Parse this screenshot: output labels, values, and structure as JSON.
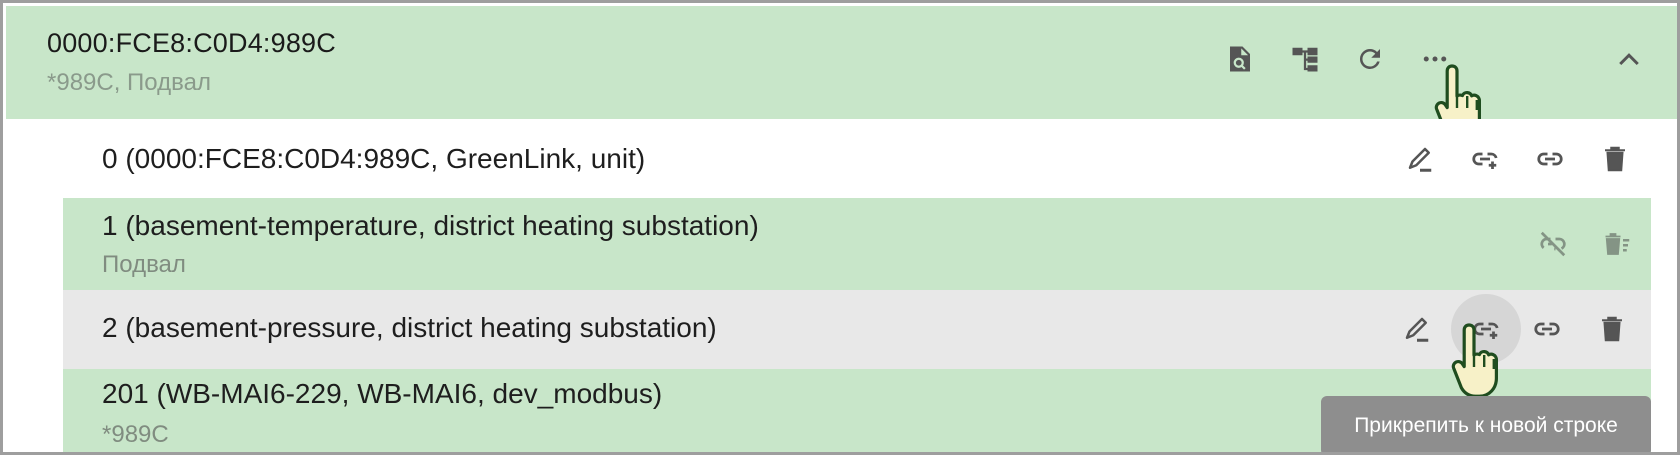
{
  "header": {
    "title": "0000:FCE8:C0D4:989C",
    "subtitle": "*989C, Подвал",
    "icons": [
      "document-search-icon",
      "tree-icon",
      "refresh-icon",
      "more-icon",
      "chevron-up-icon"
    ]
  },
  "rows": [
    {
      "main": "0 (0000:FCE8:C0D4:989C, GreenLink, unit)",
      "sub": ""
    },
    {
      "main": "1 (basement-temperature, district heating substation)",
      "sub": "Подвал"
    },
    {
      "main": "2 (basement-pressure, district heating substation)",
      "sub": ""
    },
    {
      "main": "201 (WB-MAI6-229, WB-MAI6, dev_modbus)",
      "sub": "*989C"
    }
  ],
  "tooltip": {
    "text": "Прикрепить к новой строке"
  },
  "colors": {
    "green_bg": "#c8e6c9",
    "gray_bg": "#e8e8e8",
    "icon": "#555555",
    "tooltip_bg": "#8e8e8e"
  }
}
